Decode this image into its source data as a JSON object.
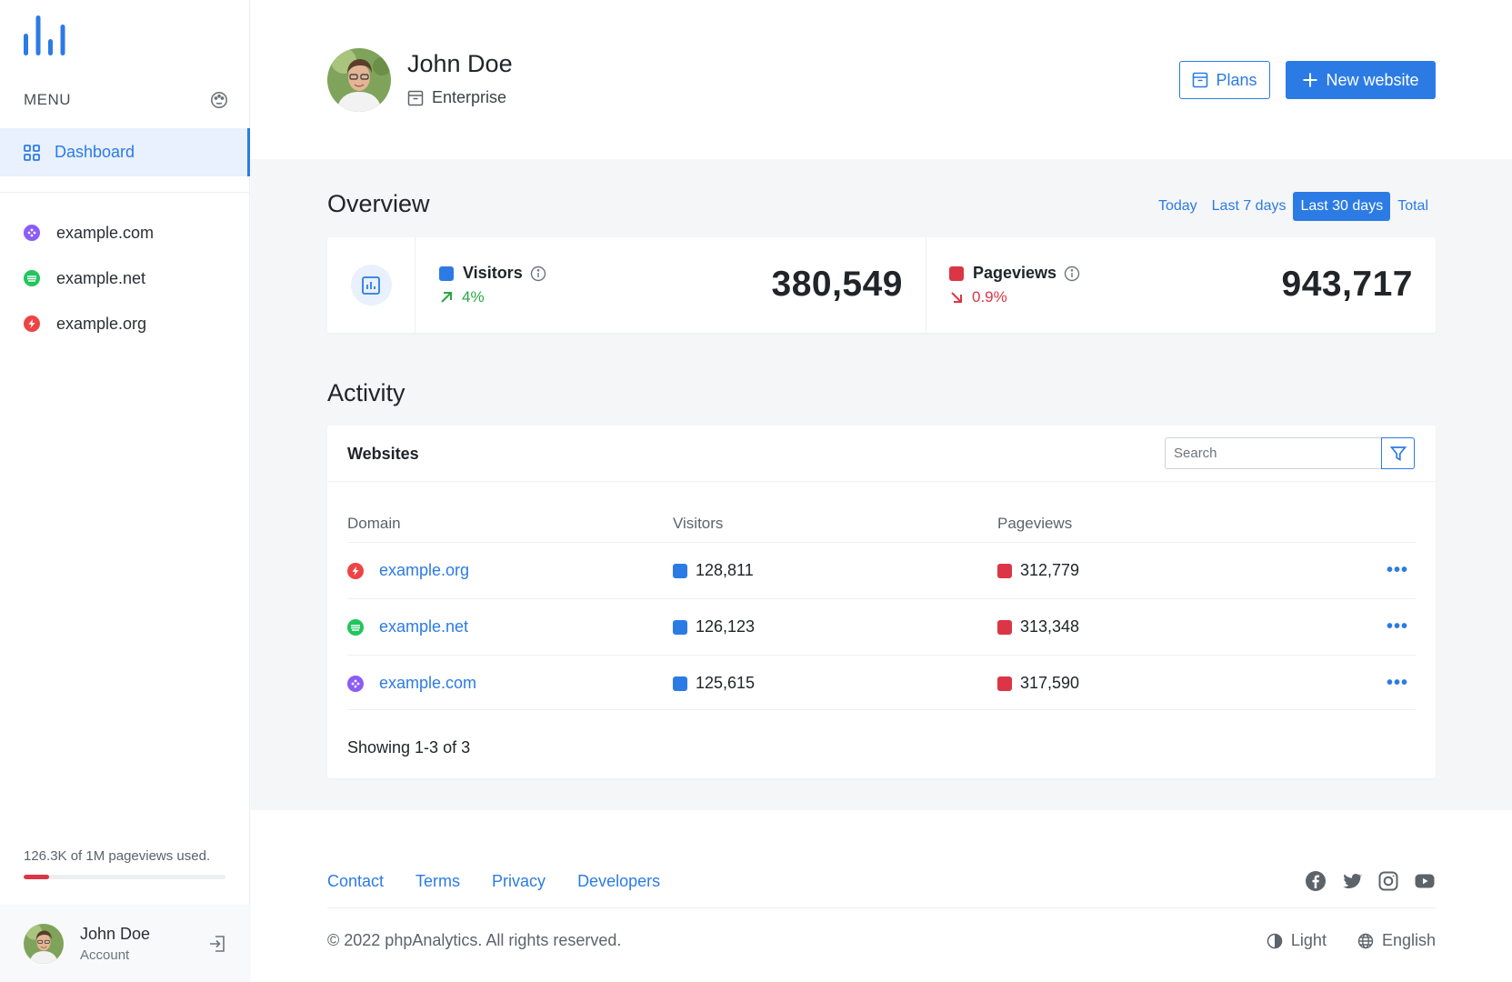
{
  "sidebar": {
    "menu_label": "MENU",
    "dashboard_label": "Dashboard",
    "sites": [
      {
        "label": "example.com",
        "color": "#8b5cf6"
      },
      {
        "label": "example.net",
        "color": "#22c55e"
      },
      {
        "label": "example.org",
        "color": "#ef4444"
      }
    ],
    "usage_text": "126.3K of 1M pageviews used.",
    "usage_fraction": 0.126,
    "account": {
      "name": "John Doe",
      "subtitle": "Account"
    }
  },
  "header": {
    "user_name": "John Doe",
    "plan": "Enterprise",
    "plans_button": "Plans",
    "new_website_button": "New website"
  },
  "overview": {
    "title": "Overview",
    "ranges": [
      "Today",
      "Last 7 days",
      "Last 30 days",
      "Total"
    ],
    "active_range": "Last 30 days",
    "visitors": {
      "label": "Visitors",
      "change": "4%",
      "value": "380,549",
      "color": "#2c7be5",
      "trend": "up"
    },
    "pageviews": {
      "label": "Pageviews",
      "change": "0.9%",
      "value": "943,717",
      "color": "#dc3545",
      "trend": "down"
    }
  },
  "activity": {
    "title": "Activity",
    "card_title": "Websites",
    "search_placeholder": "Search",
    "columns": [
      "Domain",
      "Visitors",
      "Pageviews"
    ],
    "rows": [
      {
        "domain": "example.org",
        "visitors": "128,811",
        "pageviews": "312,779"
      },
      {
        "domain": "example.net",
        "visitors": "126,123",
        "pageviews": "313,348"
      },
      {
        "domain": "example.com",
        "visitors": "125,615",
        "pageviews": "317,590"
      }
    ],
    "showing": "Showing 1-3 of 3"
  },
  "footer": {
    "links": [
      "Contact",
      "Terms",
      "Privacy",
      "Developers"
    ],
    "socials": [
      "facebook-icon",
      "twitter-icon",
      "instagram-icon",
      "youtube-icon"
    ],
    "copyright": "© 2022 phpAnalytics. All rights reserved.",
    "theme": "Light",
    "language": "English"
  },
  "colors": {
    "accent": "#2c7be5",
    "danger": "#dc3545",
    "success": "#28a745"
  }
}
